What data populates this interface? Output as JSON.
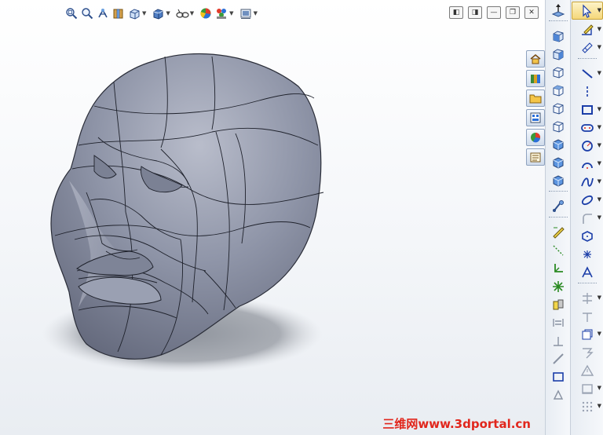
{
  "window": {
    "controls": [
      "restore-left",
      "restore-right",
      "minimize",
      "restore",
      "close"
    ]
  },
  "heads_up_toolbar": {
    "tools": [
      {
        "name": "zoom-to-fit",
        "icon": "zoom-fit-icon"
      },
      {
        "name": "zoom-to-area",
        "icon": "zoom-area-icon"
      },
      {
        "name": "previous-view",
        "icon": "previous-view-icon"
      },
      {
        "name": "section-view",
        "icon": "section-view-icon"
      },
      {
        "name": "view-orientation",
        "icon": "view-orientation-icon",
        "dropdown": true
      },
      {
        "name": "display-style",
        "icon": "display-style-icon",
        "dropdown": true
      },
      {
        "name": "hide-show-items",
        "icon": "hide-show-icon",
        "dropdown": true
      },
      {
        "name": "edit-appearance",
        "icon": "appearance-icon"
      },
      {
        "name": "apply-scene",
        "icon": "scene-icon",
        "dropdown": true
      },
      {
        "name": "view-settings",
        "icon": "view-settings-icon",
        "dropdown": true
      }
    ]
  },
  "task_pane": {
    "tabs": [
      "home",
      "design-library",
      "file-explorer",
      "view-palette",
      "appearances",
      "custom-properties"
    ]
  },
  "colors": {
    "model": "#8e94a6",
    "shadow": "#9da2ab",
    "accent": "#e1261c",
    "sketch_blue": "#1a3da8",
    "relation_green": "#2a8a22"
  },
  "watermark": {
    "text": "三维网www.3dportal.cn"
  }
}
